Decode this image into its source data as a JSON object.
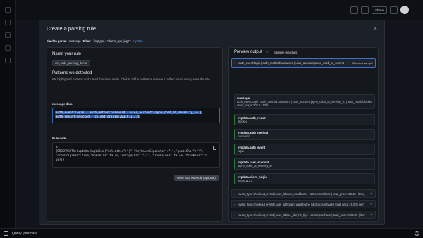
{
  "topbar": {
    "share_label": "Share"
  },
  "modal": {
    "title": "Create a parsing rule",
    "close_glyph": "×",
    "field_prefix": "Field to parse:",
    "field_value": "message",
    "filter_prefix": "Filter:",
    "filter_value": "`logtype = \"demo_app_logs\"`",
    "update_link": "Update"
  },
  "left": {
    "name_title": "Name your rule",
    "name_value": "ntr_code_parsing_demo",
    "patterns_title": "Patterns we detected",
    "patterns_desc": "We highlighted patterns and turned them into a rule. Click to add a pattern or remove it. When you're ready, save the rule.",
    "message_label": "message data",
    "message_line1": "auth_event:login | auth_method:password | user_account:jayne_cobb_at_serenity_io |",
    "message_line2": "auth_result:blocked | client_origin:203.0.113.5",
    "rule_label": "Rule code",
    "rule_code": "%\n{DROGRYDATA:kvpdata:keyValue(\"delimiter\":\"|\",\"keyValueSeparator\":\":\",\"quoteChar\":\"'\",\n\"dropOriginal\":true,\"noPrefix\":false,\"escapeChar\":\"\\\\\",\"trimValues\":false,\"trimKeys\":tr\nue})}",
    "write_button": "Write your own rule (optional)"
  },
  "right": {
    "title": "Preview output",
    "sample_label": "Sample matches",
    "selected_text": "auth_event:login | auth_method:password | user_account:jayne_cobb_at_serenity_io | a...",
    "selected_badge": "Selected sample",
    "message_block": {
      "key": "message",
      "lines": [
        "auth_event:login | auth_method:password | user_account:jayne_cobb_at_serenity_io | auth_result:blocked |",
        "client_origin:203.0.113.5"
      ]
    },
    "attributes": [
      {
        "key": "kvpdata.auth_result",
        "value": "blocked"
      },
      {
        "key": "kvpdata.auth_method",
        "value": "password"
      },
      {
        "key": "kvpdata.auth_event",
        "value": "login"
      },
      {
        "key": "kvpdata.user_account",
        "value": "jayne_cobb_at_serenity_io"
      },
      {
        "key": "kvpdata.client_origin",
        "value": "203.0.113.5"
      }
    ],
    "events": [
      "event_type:checkout_event | user_id:xxxx_washburne | action:purchase | total_price:120.45 | item_count:1 | us...",
      "event_type:checkout_event | user_id:hoban_washburne | action:purchase | total_price:15.00 | item_count:1 | us...",
      "event_type:checkout_event | user_id:zoe_alleyne_frye | action:purchase | total_price:2100.00 | item_count:12 | u..."
    ]
  },
  "footer": {
    "query_label": "Query your data",
    "help_glyph": "?"
  },
  "colors": {
    "accent": "#3b6fd0",
    "success": "#56c65e",
    "highlight": "#2f5fb3"
  }
}
